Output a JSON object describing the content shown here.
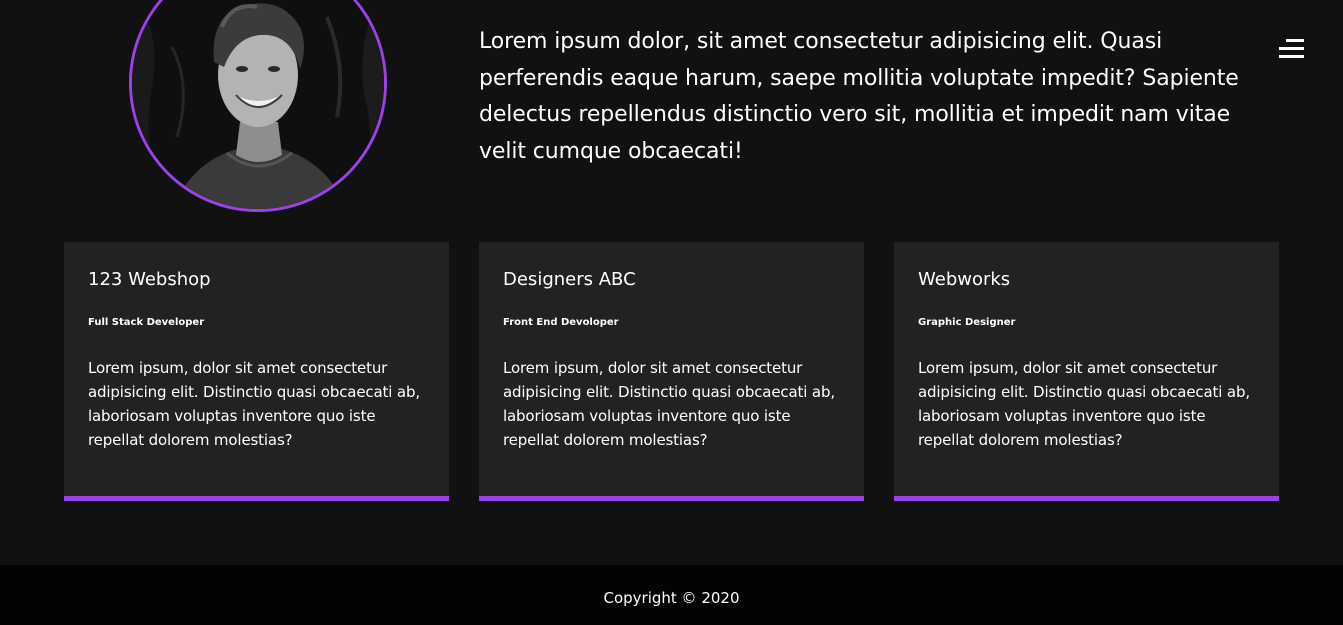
{
  "profile": {
    "avatar_icon": "profile-photo",
    "accent_color": "#9b42e6",
    "bio": "Lorem ipsum dolor, sit amet consectetur adipisicing elit. Quasi perferendis eaque harum, saepe mollitia voluptate impedit? Sapiente delectus repellendus distinctio vero sit, mollitia et impedit nam vitae velit cumque obcaecati!"
  },
  "menu": {
    "icon": "hamburger-menu-icon"
  },
  "jobs": [
    {
      "company": "123 Webshop",
      "role": "Full Stack Developer",
      "description": "Lorem ipsum, dolor sit amet consectetur adipisicing elit. Distinctio quasi obcaecati ab, laboriosam voluptas inventore quo iste repellat dolorem molestias?"
    },
    {
      "company": "Designers ABC",
      "role": "Front End Devoloper",
      "description": "Lorem ipsum, dolor sit amet consectetur adipisicing elit. Distinctio quasi obcaecati ab, laboriosam voluptas inventore quo iste repellat dolorem molestias?"
    },
    {
      "company": "Webworks",
      "role": "Graphic Designer",
      "description": "Lorem ipsum, dolor sit amet consectetur adipisicing elit. Distinctio quasi obcaecati ab, laboriosam voluptas inventore quo iste repellat dolorem molestias?"
    }
  ],
  "footer": {
    "copyright": "Copyright © 2020"
  }
}
